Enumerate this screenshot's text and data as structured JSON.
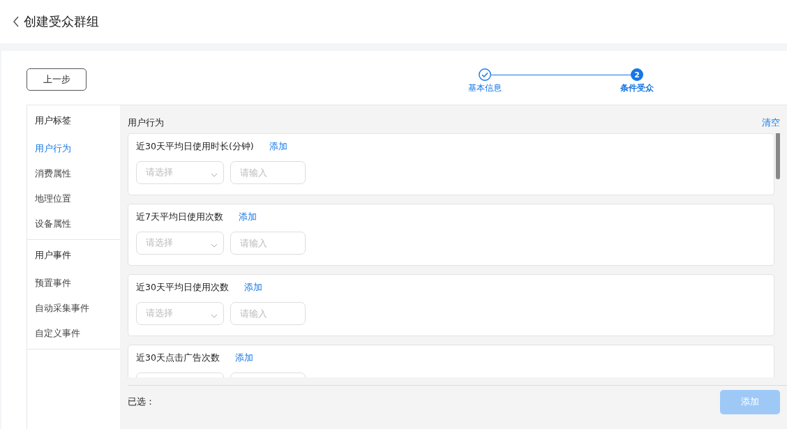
{
  "header": {
    "title": "创建受众群组"
  },
  "back_button": "上一步",
  "steps": [
    {
      "label": "基本信息",
      "completed": true,
      "current": false
    },
    {
      "label": "条件受众",
      "completed": false,
      "current": true,
      "number": "2"
    }
  ],
  "sidebar": {
    "groups": [
      {
        "title": "用户标签",
        "items": [
          {
            "label": "用户行为",
            "selected": true
          },
          {
            "label": "消费属性",
            "selected": false
          },
          {
            "label": "地理位置",
            "selected": false
          },
          {
            "label": "设备属性",
            "selected": false
          }
        ]
      },
      {
        "title": "用户事件",
        "items": [
          {
            "label": "预置事件",
            "selected": false
          },
          {
            "label": "自动采集事件",
            "selected": false
          },
          {
            "label": "自定义事件",
            "selected": false
          }
        ]
      }
    ]
  },
  "panel": {
    "title": "用户行为",
    "clear_link": "清空",
    "conditions": [
      {
        "label": "近30天平均日使用时长(分钟)",
        "add_link": "添加",
        "fields": [
          {
            "kind": "select",
            "placeholder": "请选择"
          },
          {
            "kind": "input",
            "placeholder": "请输入"
          }
        ]
      },
      {
        "label": "近7天平均日使用次数",
        "add_link": "添加",
        "fields": [
          {
            "kind": "select",
            "placeholder": "请选择"
          },
          {
            "kind": "input",
            "placeholder": "请输入"
          }
        ]
      },
      {
        "label": "近30天平均日使用次数",
        "add_link": "添加",
        "fields": [
          {
            "kind": "select",
            "placeholder": "请选择"
          },
          {
            "kind": "input",
            "placeholder": "请输入"
          }
        ]
      },
      {
        "label": "近30天点击广告次数",
        "add_link": "添加",
        "fields": [
          {
            "kind": "select"
          },
          {
            "kind": "input"
          }
        ]
      }
    ],
    "selected_label": "已选：",
    "add_button": {
      "label": "添加",
      "disabled": true
    }
  }
}
